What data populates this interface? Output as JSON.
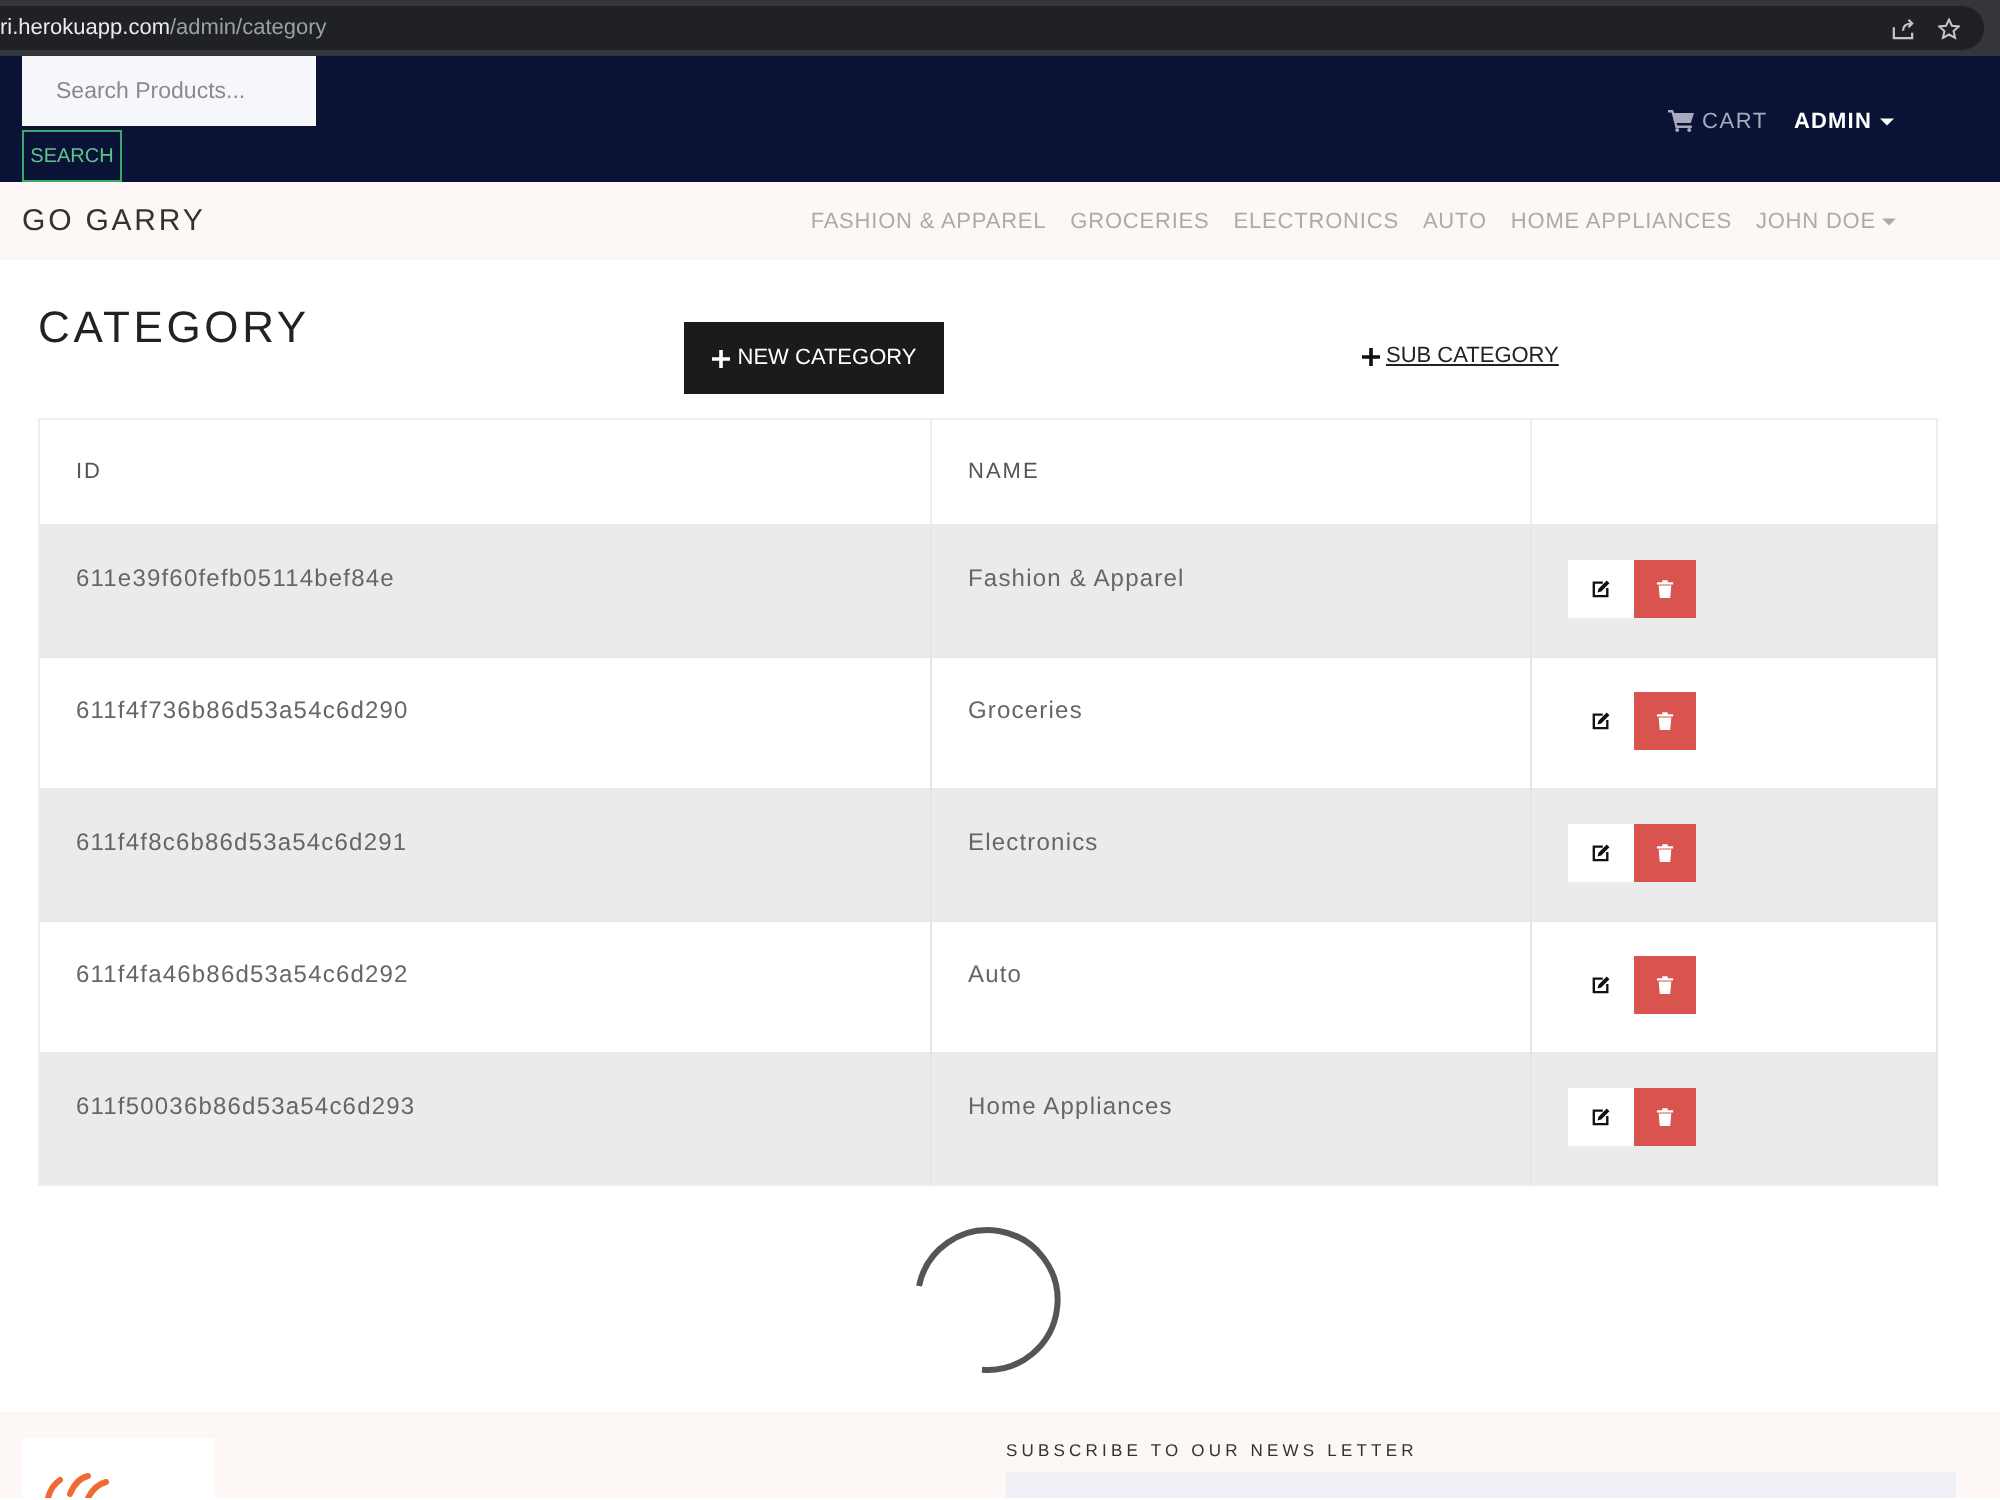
{
  "address_bar": {
    "host": "ri.herokuapp.com",
    "path": "/admin/category"
  },
  "header": {
    "search": {
      "placeholder": "Search Products..."
    },
    "search_button": "SEARCH",
    "cart": "CART",
    "account_menu": "ADMIN"
  },
  "navbar": {
    "brand": "GO GARRY",
    "links": [
      {
        "label": "FASHION & APPAREL",
        "kind": "link"
      },
      {
        "label": "GROCERIES",
        "kind": "link"
      },
      {
        "label": "ELECTRONICS",
        "kind": "link"
      },
      {
        "label": "AUTO",
        "kind": "link"
      },
      {
        "label": "HOME APPLIANCES",
        "kind": "link"
      },
      {
        "label": "JOHN DOE",
        "kind": "dropdown"
      }
    ]
  },
  "page": {
    "title": "CATEGORY",
    "new_button": "NEW CATEGORY",
    "sub_link": "SUB CATEGORY"
  },
  "table": {
    "columns": [
      "ID",
      "NAME"
    ],
    "rows": [
      {
        "id": "611e39f60fefb05114bef84e",
        "name": "Fashion & Apparel"
      },
      {
        "id": "611f4f736b86d53a54c6d290",
        "name": "Groceries"
      },
      {
        "id": "611f4f8c6b86d53a54c6d291",
        "name": "Electronics"
      },
      {
        "id": "611f4fa46b86d53a54c6d292",
        "name": "Auto"
      },
      {
        "id": "611f50036b86d53a54c6d293",
        "name": "Home Appliances"
      }
    ]
  },
  "loading": true,
  "footer": {
    "newsletter_heading": "SUBSCRIBE TO OUR NEWS LETTER"
  }
}
